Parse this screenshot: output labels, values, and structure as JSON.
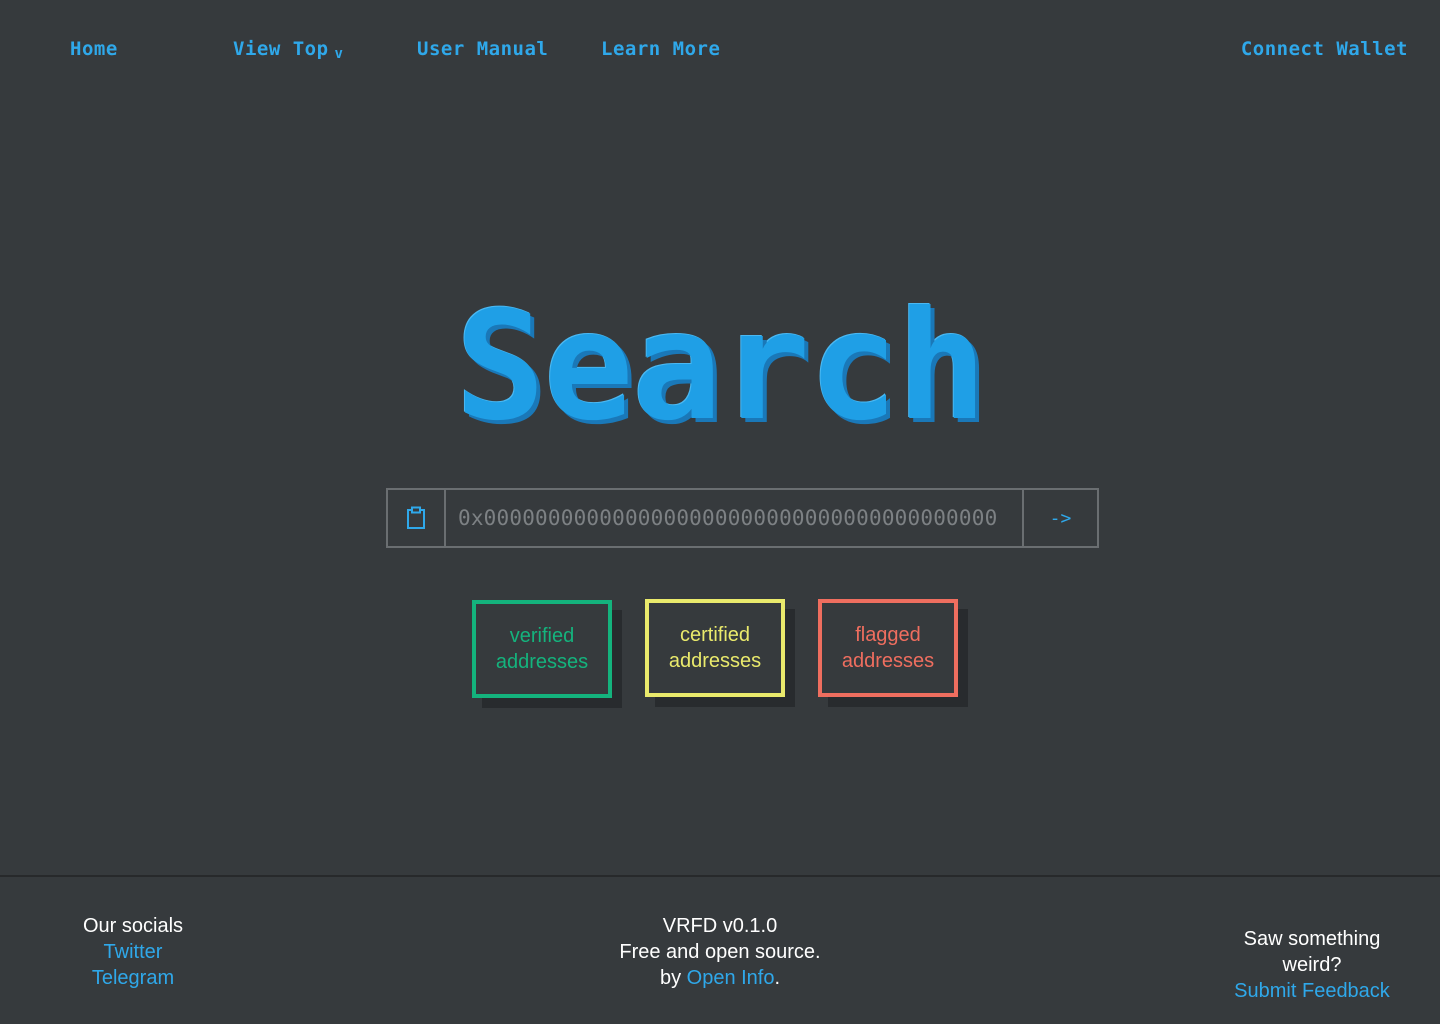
{
  "nav": {
    "home": "Home",
    "view_top": "View Top",
    "view_top_chevron": "v",
    "user_manual": "User Manual",
    "learn_more": "Learn More",
    "connect_wallet": "Connect Wallet"
  },
  "hero": {
    "title": "Search"
  },
  "search": {
    "placeholder": "0x0000000000000000000000000000000000000000",
    "clipboard_icon": "clipboard-icon",
    "go_label": "->"
  },
  "categories": [
    {
      "line1": "verified",
      "line2": "addresses",
      "color": "#14b37d"
    },
    {
      "line1": "certified",
      "line2": "addresses",
      "color": "#eaea6c"
    },
    {
      "line1": "flagged",
      "line2": "addresses",
      "color": "#ef6e5f"
    }
  ],
  "footer": {
    "socials_heading": "Our socials",
    "twitter": "Twitter",
    "telegram": "Telegram",
    "version": "VRFD v0.1.0",
    "license": "Free and open source.",
    "by_prefix": "by ",
    "org_link": "Open Info",
    "by_suffix": ".",
    "weird_heading": "Saw something weird?",
    "feedback_link": "Submit Feedback"
  },
  "colors": {
    "background": "#363a3d",
    "accent": "#2fa8ea",
    "verified": "#14b37d",
    "certified": "#eaea6c",
    "flagged": "#ef6e5f"
  }
}
